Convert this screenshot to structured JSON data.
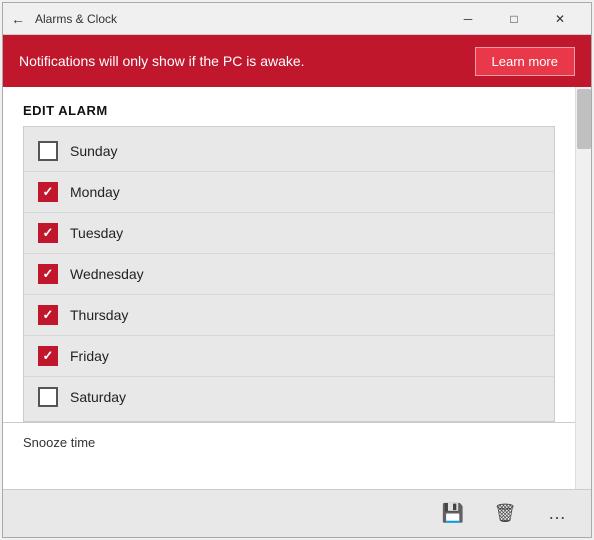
{
  "window": {
    "title": "Alarms & Clock",
    "back_label": "←",
    "min_label": "─",
    "max_label": "□",
    "close_label": "✕"
  },
  "notification": {
    "text": "Notifications will only show if the PC is awake.",
    "learn_more_label": "Learn more"
  },
  "edit_alarm": {
    "section_title": "EDIT ALARM",
    "days": [
      {
        "name": "Sunday",
        "checked": false
      },
      {
        "name": "Monday",
        "checked": true
      },
      {
        "name": "Tuesday",
        "checked": true
      },
      {
        "name": "Wednesday",
        "checked": true
      },
      {
        "name": "Thursday",
        "checked": true
      },
      {
        "name": "Friday",
        "checked": true
      },
      {
        "name": "Saturday",
        "checked": false
      }
    ]
  },
  "snooze": {
    "label": "Snooze time"
  },
  "toolbar": {
    "save_icon": "💾",
    "delete_icon": "🗑",
    "more_icon": "…"
  }
}
